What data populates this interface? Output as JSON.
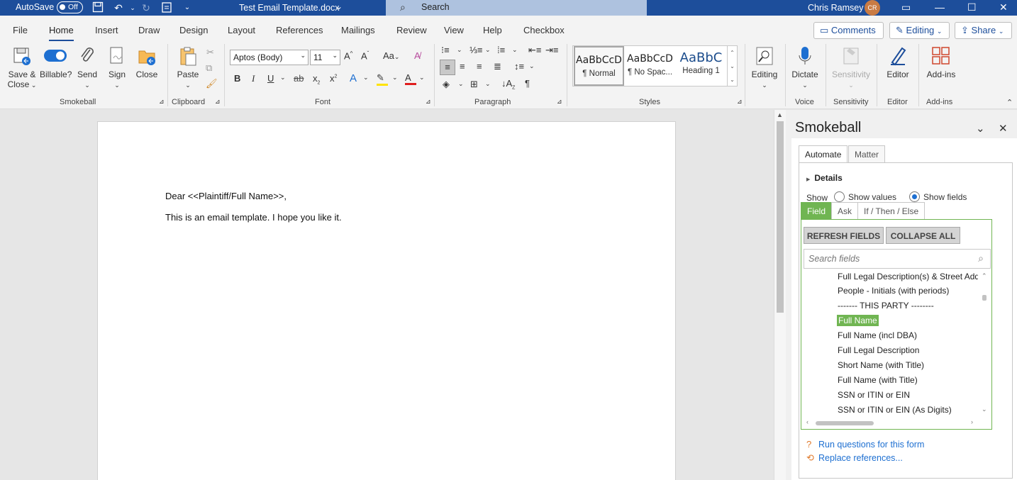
{
  "titlebar": {
    "autosave_label": "AutoSave",
    "autosave_state": "Off",
    "doc_title": "Test Email Template.docx",
    "search_placeholder": "Search",
    "user_name": "Chris Ramsey",
    "user_initials": "CR"
  },
  "menu": {
    "tabs": [
      "File",
      "Home",
      "Insert",
      "Draw",
      "Design",
      "Layout",
      "References",
      "Mailings",
      "Review",
      "View",
      "Help",
      "Checkbox"
    ],
    "active": "Home",
    "comments_label": "Comments",
    "editing_label": "Editing",
    "share_label": "Share"
  },
  "ribbon": {
    "smokeball": {
      "save_close": "Save &",
      "save_close2": "Close",
      "billable": "Billable?",
      "send": "Send",
      "sign": "Sign",
      "close": "Close",
      "group": "Smokeball"
    },
    "clipboard": {
      "paste": "Paste",
      "group": "Clipboard"
    },
    "font": {
      "name": "Aptos (Body)",
      "size": "11",
      "group": "Font"
    },
    "paragraph": {
      "group": "Paragraph"
    },
    "styles": {
      "items": [
        {
          "preview": "AaBbCcD",
          "name": "¶ Normal"
        },
        {
          "preview": "AaBbCcD",
          "name": "¶ No Spac..."
        },
        {
          "preview": "AaBbC",
          "name": "Heading 1"
        }
      ],
      "group": "Styles"
    },
    "editing": {
      "label": "Editing"
    },
    "voice": {
      "dictate": "Dictate",
      "group": "Voice"
    },
    "sensitivity": {
      "label": "Sensitivity",
      "group": "Sensitivity"
    },
    "editor": {
      "label": "Editor",
      "group": "Editor"
    },
    "addins": {
      "label": "Add-ins",
      "group": "Add-ins"
    }
  },
  "document": {
    "line1": "Dear <<Plaintiff/Full Name>>,",
    "line2": "This is an email template. I hope you like it."
  },
  "pane": {
    "title": "Smokeball",
    "tabs": [
      "Automate",
      "Matter"
    ],
    "details_label": "Details",
    "show_label": "Show",
    "show_values": "Show values",
    "show_fields": "Show fields",
    "subtabs": [
      "Field",
      "Ask",
      "If / Then / Else"
    ],
    "refresh_btn": "REFRESH FIELDS",
    "collapse_btn": "COLLAPSE ALL",
    "search_placeholder": "Search fields",
    "fields": [
      "Full Legal Description(s) & Street Address",
      "People - Initials (with periods)",
      "------- THIS PARTY --------",
      "Full Name",
      "Full Name (incl DBA)",
      "Full Legal Description",
      "Short Name (with Title)",
      "Full Name (with Title)",
      "SSN or ITIN or EIN",
      "SSN or ITIN or EIN (As Digits)"
    ],
    "selected_field": "Full Name",
    "link_run": "Run questions for this form",
    "link_replace": "Replace references..."
  },
  "colors": {
    "brand": "#1d4e9b",
    "accent_green": "#70b552",
    "link": "#1d6fd1"
  }
}
